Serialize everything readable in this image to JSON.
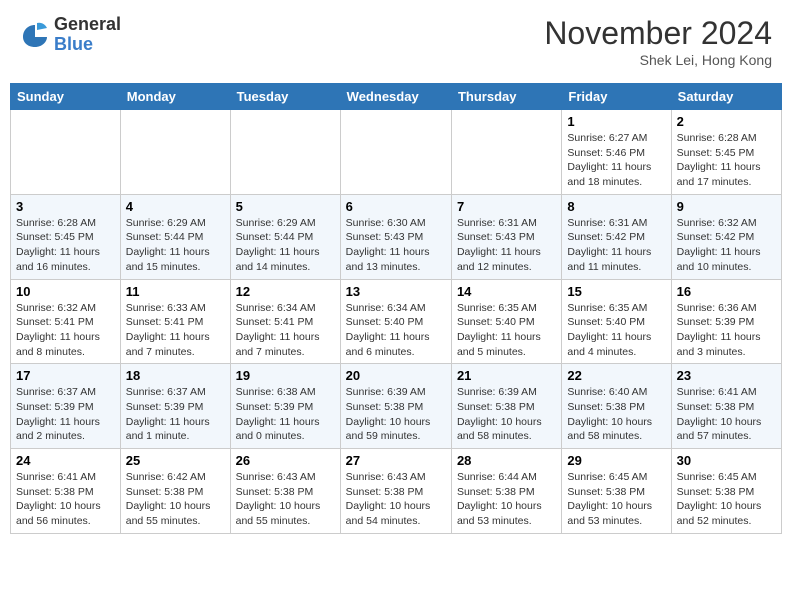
{
  "header": {
    "logo_general": "General",
    "logo_blue": "Blue",
    "month_title": "November 2024",
    "location": "Shek Lei, Hong Kong"
  },
  "weekdays": [
    "Sunday",
    "Monday",
    "Tuesday",
    "Wednesday",
    "Thursday",
    "Friday",
    "Saturday"
  ],
  "weeks": [
    [
      {
        "day": "",
        "info": ""
      },
      {
        "day": "",
        "info": ""
      },
      {
        "day": "",
        "info": ""
      },
      {
        "day": "",
        "info": ""
      },
      {
        "day": "",
        "info": ""
      },
      {
        "day": "1",
        "info": "Sunrise: 6:27 AM\nSunset: 5:46 PM\nDaylight: 11 hours and 18 minutes."
      },
      {
        "day": "2",
        "info": "Sunrise: 6:28 AM\nSunset: 5:45 PM\nDaylight: 11 hours and 17 minutes."
      }
    ],
    [
      {
        "day": "3",
        "info": "Sunrise: 6:28 AM\nSunset: 5:45 PM\nDaylight: 11 hours and 16 minutes."
      },
      {
        "day": "4",
        "info": "Sunrise: 6:29 AM\nSunset: 5:44 PM\nDaylight: 11 hours and 15 minutes."
      },
      {
        "day": "5",
        "info": "Sunrise: 6:29 AM\nSunset: 5:44 PM\nDaylight: 11 hours and 14 minutes."
      },
      {
        "day": "6",
        "info": "Sunrise: 6:30 AM\nSunset: 5:43 PM\nDaylight: 11 hours and 13 minutes."
      },
      {
        "day": "7",
        "info": "Sunrise: 6:31 AM\nSunset: 5:43 PM\nDaylight: 11 hours and 12 minutes."
      },
      {
        "day": "8",
        "info": "Sunrise: 6:31 AM\nSunset: 5:42 PM\nDaylight: 11 hours and 11 minutes."
      },
      {
        "day": "9",
        "info": "Sunrise: 6:32 AM\nSunset: 5:42 PM\nDaylight: 11 hours and 10 minutes."
      }
    ],
    [
      {
        "day": "10",
        "info": "Sunrise: 6:32 AM\nSunset: 5:41 PM\nDaylight: 11 hours and 8 minutes."
      },
      {
        "day": "11",
        "info": "Sunrise: 6:33 AM\nSunset: 5:41 PM\nDaylight: 11 hours and 7 minutes."
      },
      {
        "day": "12",
        "info": "Sunrise: 6:34 AM\nSunset: 5:41 PM\nDaylight: 11 hours and 7 minutes."
      },
      {
        "day": "13",
        "info": "Sunrise: 6:34 AM\nSunset: 5:40 PM\nDaylight: 11 hours and 6 minutes."
      },
      {
        "day": "14",
        "info": "Sunrise: 6:35 AM\nSunset: 5:40 PM\nDaylight: 11 hours and 5 minutes."
      },
      {
        "day": "15",
        "info": "Sunrise: 6:35 AM\nSunset: 5:40 PM\nDaylight: 11 hours and 4 minutes."
      },
      {
        "day": "16",
        "info": "Sunrise: 6:36 AM\nSunset: 5:39 PM\nDaylight: 11 hours and 3 minutes."
      }
    ],
    [
      {
        "day": "17",
        "info": "Sunrise: 6:37 AM\nSunset: 5:39 PM\nDaylight: 11 hours and 2 minutes."
      },
      {
        "day": "18",
        "info": "Sunrise: 6:37 AM\nSunset: 5:39 PM\nDaylight: 11 hours and 1 minute."
      },
      {
        "day": "19",
        "info": "Sunrise: 6:38 AM\nSunset: 5:39 PM\nDaylight: 11 hours and 0 minutes."
      },
      {
        "day": "20",
        "info": "Sunrise: 6:39 AM\nSunset: 5:38 PM\nDaylight: 10 hours and 59 minutes."
      },
      {
        "day": "21",
        "info": "Sunrise: 6:39 AM\nSunset: 5:38 PM\nDaylight: 10 hours and 58 minutes."
      },
      {
        "day": "22",
        "info": "Sunrise: 6:40 AM\nSunset: 5:38 PM\nDaylight: 10 hours and 58 minutes."
      },
      {
        "day": "23",
        "info": "Sunrise: 6:41 AM\nSunset: 5:38 PM\nDaylight: 10 hours and 57 minutes."
      }
    ],
    [
      {
        "day": "24",
        "info": "Sunrise: 6:41 AM\nSunset: 5:38 PM\nDaylight: 10 hours and 56 minutes."
      },
      {
        "day": "25",
        "info": "Sunrise: 6:42 AM\nSunset: 5:38 PM\nDaylight: 10 hours and 55 minutes."
      },
      {
        "day": "26",
        "info": "Sunrise: 6:43 AM\nSunset: 5:38 PM\nDaylight: 10 hours and 55 minutes."
      },
      {
        "day": "27",
        "info": "Sunrise: 6:43 AM\nSunset: 5:38 PM\nDaylight: 10 hours and 54 minutes."
      },
      {
        "day": "28",
        "info": "Sunrise: 6:44 AM\nSunset: 5:38 PM\nDaylight: 10 hours and 53 minutes."
      },
      {
        "day": "29",
        "info": "Sunrise: 6:45 AM\nSunset: 5:38 PM\nDaylight: 10 hours and 53 minutes."
      },
      {
        "day": "30",
        "info": "Sunrise: 6:45 AM\nSunset: 5:38 PM\nDaylight: 10 hours and 52 minutes."
      }
    ]
  ]
}
